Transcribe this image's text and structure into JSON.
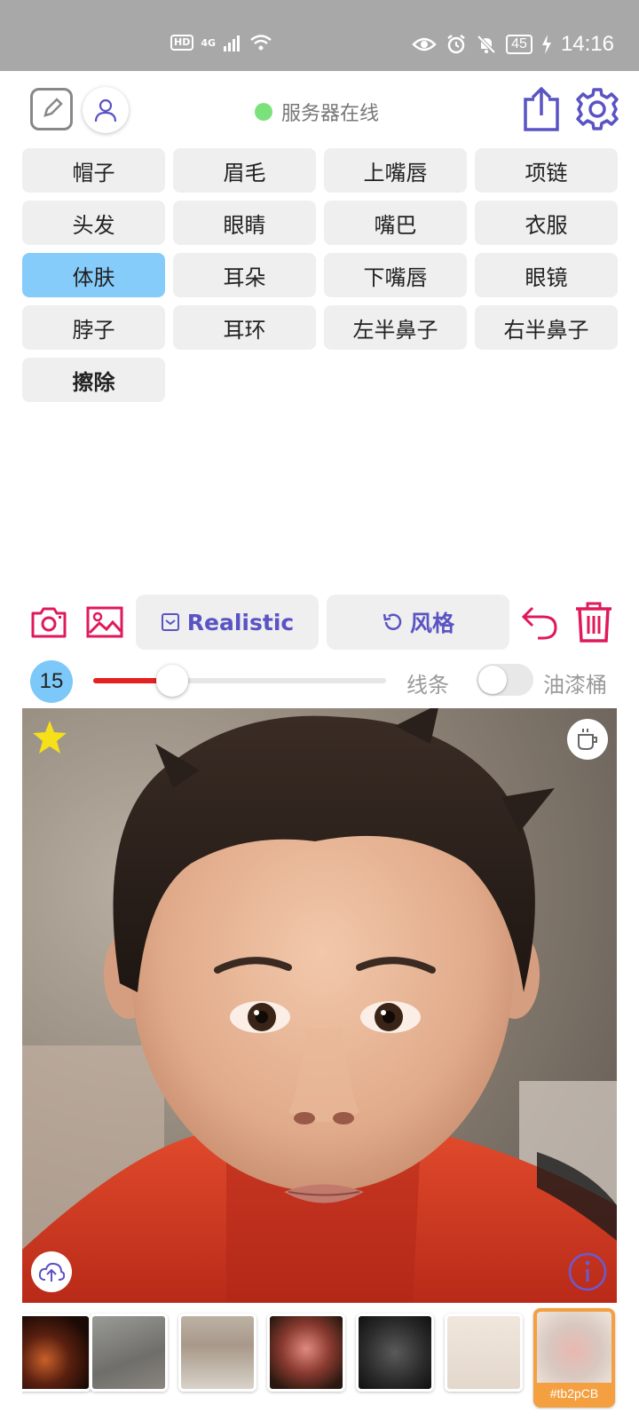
{
  "status_bar": {
    "network_badges": [
      "HD",
      "4G"
    ],
    "battery": "45",
    "time": "14:16"
  },
  "header": {
    "server_status": "服务器在线",
    "server_status_color": "#7be27b"
  },
  "parts": [
    {
      "label": "帽子",
      "active": false
    },
    {
      "label": "眉毛",
      "active": false
    },
    {
      "label": "上嘴唇",
      "active": false
    },
    {
      "label": "项链",
      "active": false
    },
    {
      "label": "头发",
      "active": false
    },
    {
      "label": "眼睛",
      "active": false
    },
    {
      "label": "嘴巴",
      "active": false
    },
    {
      "label": "衣服",
      "active": false
    },
    {
      "label": "体肤",
      "active": true
    },
    {
      "label": "耳朵",
      "active": false
    },
    {
      "label": "下嘴唇",
      "active": false
    },
    {
      "label": "眼镜",
      "active": false
    },
    {
      "label": "脖子",
      "active": false
    },
    {
      "label": "耳环",
      "active": false
    },
    {
      "label": "左半鼻子",
      "active": false
    },
    {
      "label": "右半鼻子",
      "active": false
    },
    {
      "label": "擦除",
      "active": false,
      "bold": true
    }
  ],
  "toolbar": {
    "mode_label": "Realistic",
    "style_label": "风格",
    "accent_color": "#e0195a",
    "brand_color": "#5a53c4"
  },
  "brush": {
    "size": "15",
    "slider_fraction": 0.27,
    "line_label": "线条",
    "bucket_label": "油漆桶",
    "bucket_enabled": false
  },
  "gallery": {
    "selected_tag": "#tb2pCB"
  }
}
